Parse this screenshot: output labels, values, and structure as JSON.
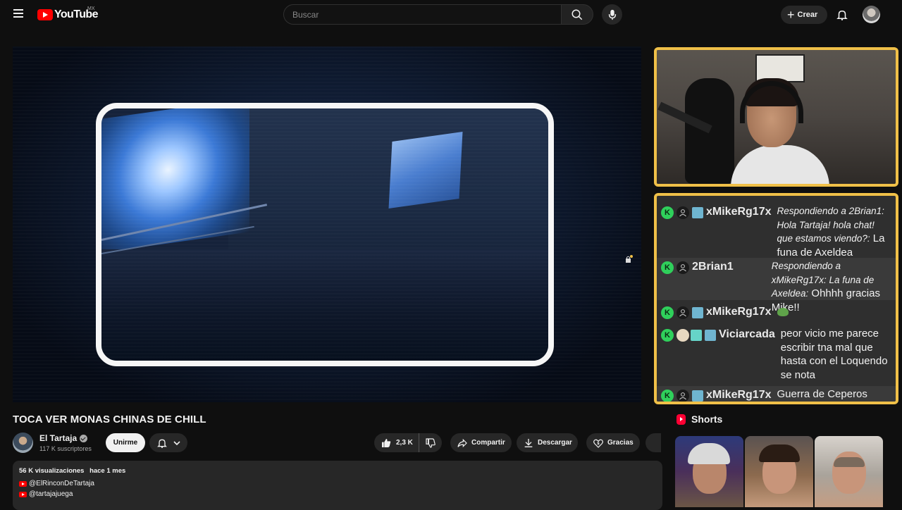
{
  "header": {
    "logo_text": "YouTube",
    "country_code": "MX",
    "search_placeholder": "Buscar",
    "create_label": "Crear"
  },
  "video": {
    "title": "TOCA VER MONAS CHINAS DE CHILL"
  },
  "channel": {
    "name": "El Tartaja",
    "subscribers": "117 K suscriptores",
    "join_label": "Unirme"
  },
  "actions": {
    "likes": "2,3 K",
    "share_label": "Compartir",
    "download_label": "Descargar",
    "thanks_label": "Gracias"
  },
  "description": {
    "views": "56 K visualizaciones",
    "date": "hace 1 mes",
    "links": [
      "@ElRinconDeTartaja",
      "@tartajajuega"
    ]
  },
  "chat": {
    "messages": [
      {
        "user": "xMikeRg17x",
        "reply": "Respondiendo a 2Brian1: Hola Tartaja! hola chat! que estamos viendo?:",
        "text": "La funa de Axeldea"
      },
      {
        "user": "2Brian1",
        "reply": "Respondiendo a xMikeRg17x: La funa de Axeldea:",
        "text": "Ohhhh gracias Mike!!"
      },
      {
        "user": "xMikeRg17x",
        "reply": "",
        "text": ""
      },
      {
        "user": "Viciarcada",
        "reply": "",
        "text": "peor vicio me parece escribir tna mal que hasta con el Loquendo se nota"
      },
      {
        "user": "xMikeRg17x",
        "reply": "",
        "text": "Guerra de Ceperos"
      }
    ],
    "badge_letter": "K"
  },
  "shorts": {
    "title": "Shorts"
  },
  "colors": {
    "background": "#0f0f0f",
    "accent_red": "#ff0000",
    "overlay_border": "#f0c048",
    "kick_green": "#2fd05b"
  }
}
